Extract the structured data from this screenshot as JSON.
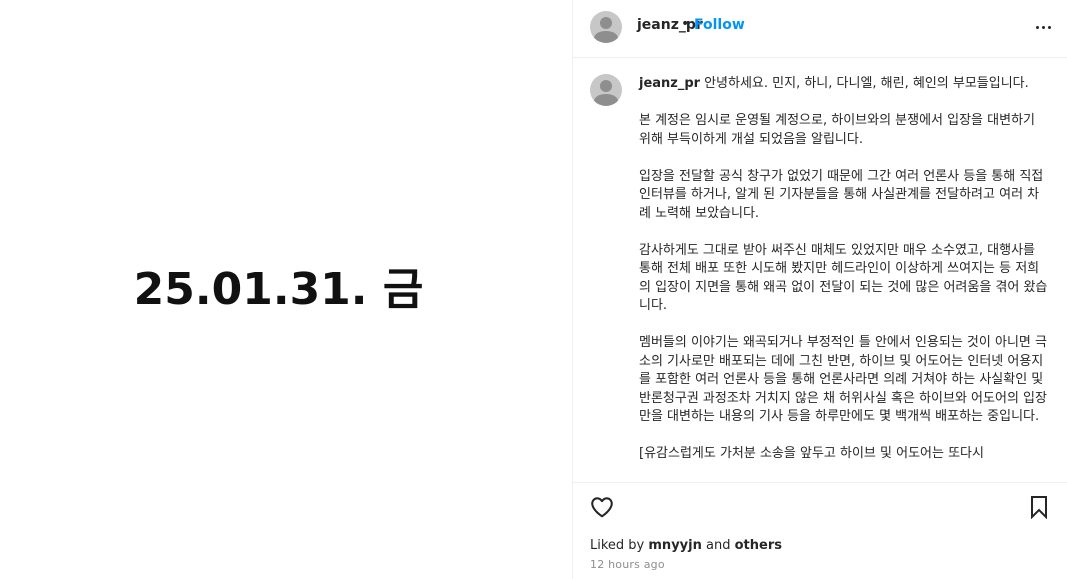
{
  "image": {
    "text": "25.01.31. 금"
  },
  "header": {
    "username": "jeanz_pr",
    "separator": "•",
    "follow_label": "Follow",
    "more_icon": "more-horizontal-icon"
  },
  "caption": {
    "username": "jeanz_pr",
    "paragraphs": [
      "안녕하세요. 민지, 하니, 다니엘, 해린, 혜인의 부모들입니다.",
      "본 계정은 임시로 운영될 계정으로, 하이브와의 분쟁에서 입장을 대변하기 위해 부득이하게 개설 되었음을 알립니다.",
      "입장을 전달할 공식 창구가 없었기 때문에 그간 여러 언론사 등을 통해 직접 인터뷰를 하거나, 알게 된 기자분들을 통해 사실관계를 전달하려고 여러 차례 노력해 보았습니다.",
      "감사하게도 그대로 받아 써주신 매체도 있었지만 매우 소수였고, 대행사를 통해 전체 배포 또한 시도해 봤지만 헤드라인이 이상하게 쓰여지는 등 저희의 입장이 지면을 통해 왜곡 없이 전달이 되는 것에 많은 어려움을 겪어 왔습니다.",
      "멤버들의 이야기는 왜곡되거나 부정적인 틀 안에서 인용되는 것이 아니면 극소의 기사로만 배포되는 데에 그친 반면, 하이브 및 어도어는 인터넷 어용지를 포함한 여러 언론사 등을 통해 언론사라면 의례 거쳐야 하는 사실확인 및 반론청구권 과정조차 거치지 않은 채 허위사실 혹은 하이브와 어도어의 입장만을 대변하는 내용의 기사 등을 하루만에도 몇 백개씩 배포하는 중입니다.",
      "[유감스럽게도 가처분 소송을 앞두고 하이브 및 어도어는 또다시"
    ]
  },
  "actions": {
    "like_icon": "heart-icon",
    "save_icon": "bookmark-icon",
    "liked_by_prefix": "Liked by",
    "liked_by_user": "mnyyjn",
    "liked_by_and": "and",
    "liked_by_others": "others",
    "timestamp": "12 hours ago"
  },
  "colors": {
    "accent": "#0095f6",
    "text": "#262626",
    "muted": "#8e8e8e",
    "border": "#efefef"
  }
}
